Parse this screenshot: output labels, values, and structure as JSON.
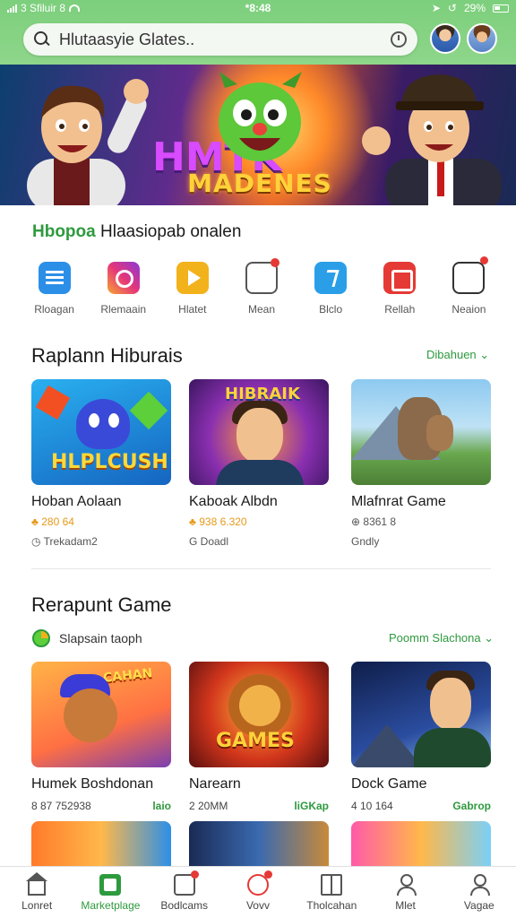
{
  "status": {
    "carrier": "3 Sfiluir 8",
    "time": "*8:48",
    "battery": "29%"
  },
  "search": {
    "placeholder": "Hlutaasyie Glates.."
  },
  "hero": {
    "big_text": "HMTK",
    "title": "MADENES"
  },
  "categories": {
    "heading_green": "Hbopoa",
    "heading_rest": "Hlaasiopab onalen",
    "items": [
      {
        "label": "Rloagan",
        "icon": "list-icon"
      },
      {
        "label": "Rlemaain",
        "icon": "instagram-icon"
      },
      {
        "label": "Hlatet",
        "icon": "play-icon"
      },
      {
        "label": "Mean",
        "icon": "chat-icon"
      },
      {
        "label": "Blclo",
        "icon": "messenger-icon"
      },
      {
        "label": "Rellah",
        "icon": "red-app-icon"
      },
      {
        "label": "Neaion",
        "icon": "box-icon"
      }
    ]
  },
  "section1": {
    "title": "Raplann Hiburais",
    "link": "Dibahuen",
    "cards": [
      {
        "name": "Hoban Aolaan",
        "meta": "280 64",
        "sub": "Trekadam2",
        "art": "HLPLCUSH"
      },
      {
        "name": "Kaboak Albdn",
        "meta": "938 6.320",
        "sub": "G Doadl",
        "art": "HIBRAIK"
      },
      {
        "name": "Mlafnrat Game",
        "meta": "8361 8",
        "sub": "Gndly",
        "art": ""
      }
    ]
  },
  "section2": {
    "title": "Rerapunt Game",
    "link": "Poomm Slachona",
    "subtag": "Slapsain taoph",
    "cards": [
      {
        "name": "Humek Boshdonan",
        "stat": "8 87 752938",
        "action": "laio",
        "art": "CAHAN"
      },
      {
        "name": "Narearn",
        "stat": "2 20MM",
        "action": "liGKap",
        "art": "GAMES"
      },
      {
        "name": "Dock Game",
        "stat": "4 10 164",
        "action": "Gabrop",
        "art": ""
      }
    ]
  },
  "bottom_nav": [
    {
      "label": "Lonret",
      "icon": "home-icon"
    },
    {
      "label": "Marketplage",
      "icon": "marketplace-icon",
      "active": true
    },
    {
      "label": "Bodlcams",
      "icon": "games-icon"
    },
    {
      "label": "Vovv",
      "icon": "favorite-icon"
    },
    {
      "label": "Tholcahan",
      "icon": "book-icon"
    },
    {
      "label": "Mlet",
      "icon": "user-icon"
    },
    {
      "label": "Vagae",
      "icon": "profile-icon"
    }
  ],
  "colors": {
    "header_green": "#7ccf7c",
    "accent_green": "#2e9a3e",
    "badge_red": "#e53935"
  }
}
